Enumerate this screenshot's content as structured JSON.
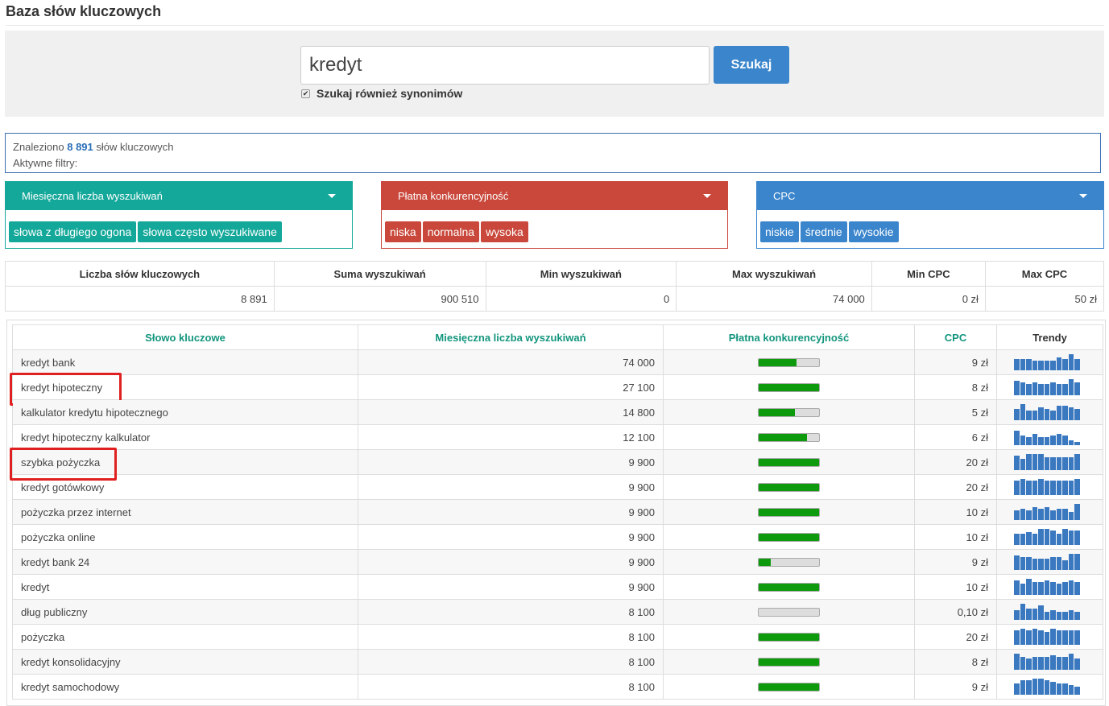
{
  "page": {
    "title": "Baza słów kluczowych"
  },
  "search": {
    "value": "kredyt",
    "placeholder": "",
    "button_label": "Szukaj",
    "synonyms_label": "Szukaj również synonimów",
    "synonyms_checked": true
  },
  "summary": {
    "found_prefix": "Znaleziono",
    "found_count": "8 891",
    "found_suffix": "słów kluczowych",
    "active_filters": "Aktywne filtry:"
  },
  "filters": [
    {
      "title": "Miesięczna liczba wyszukiwań",
      "color": "#14a89a",
      "options": [
        "słowa z długiego ogona",
        "słowa często wyszukiwane"
      ]
    },
    {
      "title": "Płatna konkurencyjność",
      "color": "#c9483b",
      "options": [
        "niska",
        "normalna",
        "wysoka"
      ]
    },
    {
      "title": "CPC",
      "color": "#3a85cc",
      "options": [
        "niskie",
        "średnie",
        "wysokie"
      ]
    }
  ],
  "stats": {
    "headers": [
      "Liczba słów kluczowych",
      "Suma wyszukiwań",
      "Min wyszukiwań",
      "Max wyszukiwań",
      "Min CPC",
      "Max CPC"
    ],
    "values": [
      "8 891",
      "900 510",
      "0",
      "74 000",
      "0 zł",
      "50 zł"
    ]
  },
  "keywords": {
    "headers": [
      "Słowo kluczowe",
      "Miesięczna liczba wyszukiwań",
      "Płatna konkurencyjność",
      "CPC",
      "Trendy"
    ],
    "rows": [
      {
        "keyword": "kredyt bank",
        "searches": "74 000",
        "competition": 0.62,
        "cpc": "9 zł",
        "highlighted": false,
        "trend": [
          0.7,
          0.7,
          0.7,
          0.6,
          0.6,
          0.6,
          0.6,
          0.8,
          0.7,
          1.0,
          0.7
        ]
      },
      {
        "keyword": "kredyt hipoteczny",
        "searches": "27 100",
        "competition": 1.0,
        "cpc": "8 zł",
        "highlighted": true,
        "trend": [
          0.9,
          0.8,
          0.7,
          0.8,
          0.7,
          0.7,
          0.8,
          0.7,
          0.7,
          1.0,
          0.8
        ]
      },
      {
        "keyword": "kalkulator kredytu hipotecznego",
        "searches": "14 800",
        "competition": 0.6,
        "cpc": "5 zł",
        "highlighted": false,
        "trend": [
          0.7,
          1.0,
          0.6,
          0.6,
          0.8,
          0.7,
          0.6,
          0.9,
          0.9,
          0.8,
          0.7
        ]
      },
      {
        "keyword": "kredyt hipoteczny kalkulator",
        "searches": "12 100",
        "competition": 0.8,
        "cpc": "6 zł",
        "highlighted": false,
        "trend": [
          0.9,
          0.6,
          0.5,
          0.7,
          0.5,
          0.5,
          0.6,
          0.7,
          0.6,
          0.3,
          0.2
        ]
      },
      {
        "keyword": "szybka pożyczka",
        "searches": "9 900",
        "competition": 1.0,
        "cpc": "20 zł",
        "highlighted": true,
        "trend": [
          0.9,
          0.7,
          1.0,
          1.0,
          1.0,
          0.8,
          0.8,
          0.8,
          0.8,
          0.8,
          1.0
        ]
      },
      {
        "keyword": "kredyt gotówkowy",
        "searches": "9 900",
        "competition": 1.0,
        "cpc": "20 zł",
        "highlighted": false,
        "trend": [
          0.9,
          1.0,
          0.9,
          0.9,
          1.0,
          0.9,
          0.9,
          0.9,
          0.9,
          0.9,
          1.0
        ]
      },
      {
        "keyword": "pożyczka przez internet",
        "searches": "9 900",
        "competition": 1.0,
        "cpc": "10 zł",
        "highlighted": false,
        "trend": [
          0.6,
          0.7,
          0.6,
          0.8,
          0.7,
          0.8,
          0.6,
          0.7,
          0.7,
          0.5,
          1.0
        ]
      },
      {
        "keyword": "pożyczka online",
        "searches": "9 900",
        "competition": 1.0,
        "cpc": "10 zł",
        "highlighted": false,
        "trend": [
          0.7,
          0.7,
          0.8,
          0.7,
          1.0,
          1.0,
          0.9,
          0.7,
          1.0,
          0.9,
          0.9
        ]
      },
      {
        "keyword": "kredyt bank 24",
        "searches": "9 900",
        "competition": 0.2,
        "cpc": "9 zł",
        "highlighted": false,
        "trend": [
          0.9,
          0.8,
          0.8,
          0.7,
          0.7,
          0.7,
          0.8,
          0.8,
          0.6,
          1.0,
          1.0
        ]
      },
      {
        "keyword": "kredyt",
        "searches": "9 900",
        "competition": 1.0,
        "cpc": "10 zł",
        "highlighted": false,
        "trend": [
          0.9,
          0.7,
          1.0,
          0.8,
          0.8,
          0.9,
          0.8,
          0.7,
          0.8,
          0.9,
          0.8
        ]
      },
      {
        "keyword": "dług publiczny",
        "searches": "8 100",
        "competition": 0.0,
        "cpc": "0,10 zł",
        "highlighted": false,
        "trend": [
          0.6,
          1.0,
          0.7,
          0.7,
          0.9,
          0.5,
          0.6,
          0.5,
          0.5,
          0.6,
          0.5
        ]
      },
      {
        "keyword": "pożyczka",
        "searches": "8 100",
        "competition": 1.0,
        "cpc": "20 zł",
        "highlighted": false,
        "trend": [
          0.9,
          1.0,
          0.9,
          1.0,
          0.9,
          0.8,
          1.0,
          0.9,
          0.9,
          0.9,
          0.9
        ]
      },
      {
        "keyword": "kredyt konsolidacyjny",
        "searches": "8 100",
        "competition": 1.0,
        "cpc": "8 zł",
        "highlighted": false,
        "trend": [
          1.0,
          0.8,
          0.7,
          0.8,
          0.8,
          0.8,
          0.9,
          0.8,
          0.8,
          1.0,
          0.7
        ]
      },
      {
        "keyword": "kredyt samochodowy",
        "searches": "8 100",
        "competition": 1.0,
        "cpc": "9 zł",
        "highlighted": false,
        "trend": [
          0.7,
          0.9,
          0.9,
          1.0,
          1.0,
          0.9,
          0.8,
          0.7,
          0.7,
          0.6,
          0.5
        ]
      }
    ]
  }
}
